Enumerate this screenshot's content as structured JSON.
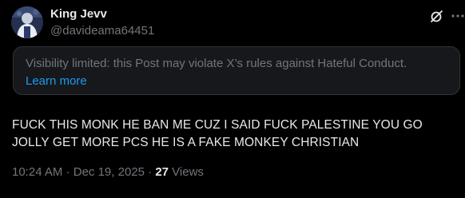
{
  "author": {
    "display_name": "King Jevv",
    "handle": "@davideama64451"
  },
  "icons": {
    "avatar": "profile-photo",
    "grok": "grok-slash-icon",
    "more": "more-dots-icon"
  },
  "notice": {
    "text": "Visibility limited: this Post may violate X’s rules against Hateful Conduct.",
    "link": "Learn more"
  },
  "post": {
    "text": "FUCK THIS MONK HE BAN ME CUZ I SAID FUCK PALESTINE YOU GO JOLLY GET MORE PCS HE IS A FAKE MONKEY CHRISTIAN"
  },
  "meta": {
    "time": "10:24 AM",
    "date": "Dec 19, 2025",
    "separator": "·",
    "views_count": "27",
    "views_label": "Views"
  },
  "colors": {
    "background": "#000000",
    "text_primary": "#e7e9ea",
    "text_secondary": "#71767b",
    "accent": "#1d9bf0",
    "notice_bg": "#16181c",
    "border": "#2f3336"
  }
}
